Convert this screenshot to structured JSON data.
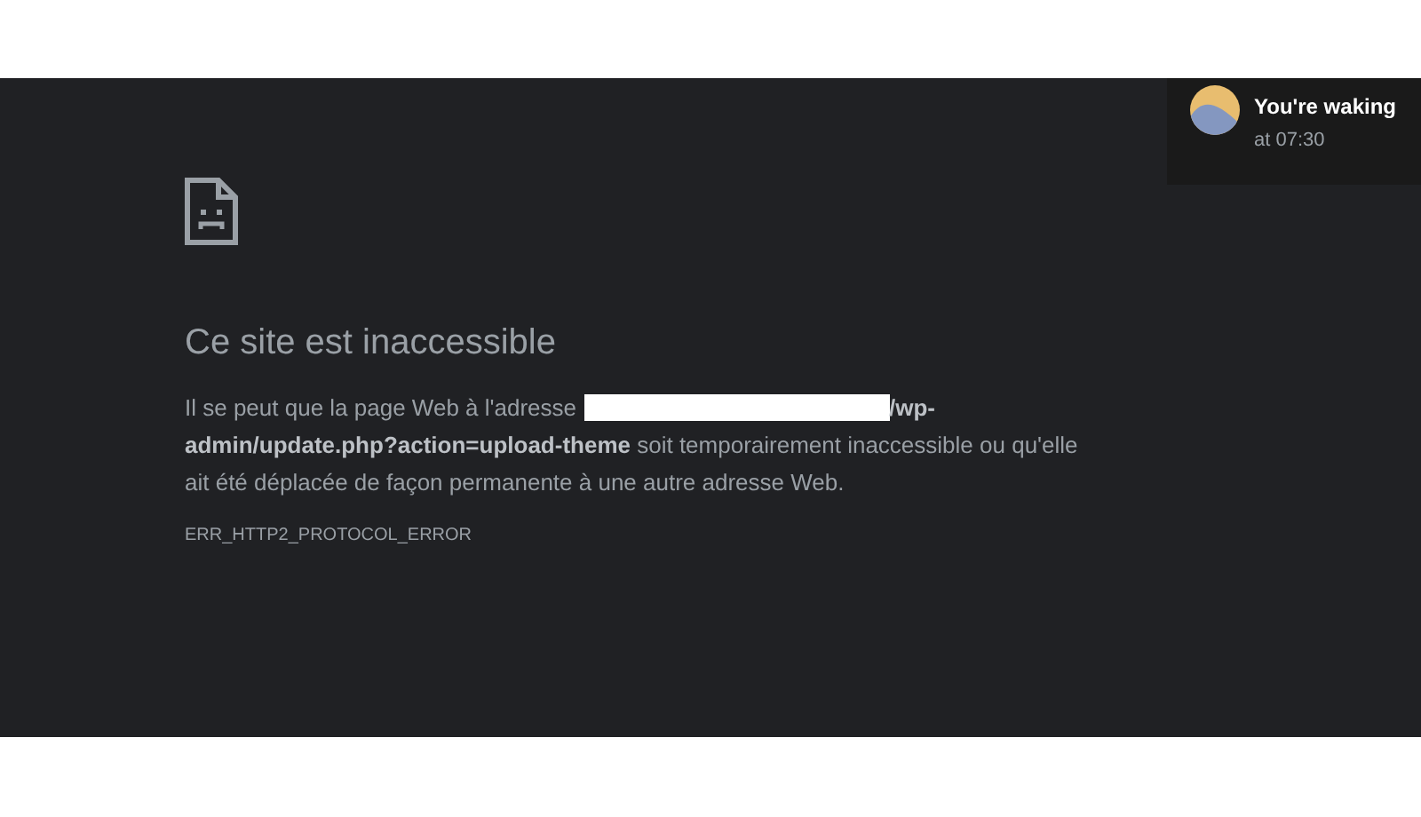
{
  "error_page": {
    "title": "Ce site est inaccessible",
    "description_before": "Il se peut que la page Web à l'adresse",
    "description_after": "**/wp-admin/update.php?action=upload-theme** soit temporairement inaccessible ou qu'elle ait été déplacée de façon permanente à une autre adresse Web.",
    "error_code": "ERR_HTTP2_PROTOCOL_ERROR"
  },
  "notification": {
    "title": "You're waking",
    "subtitle": "at 07:30"
  }
}
